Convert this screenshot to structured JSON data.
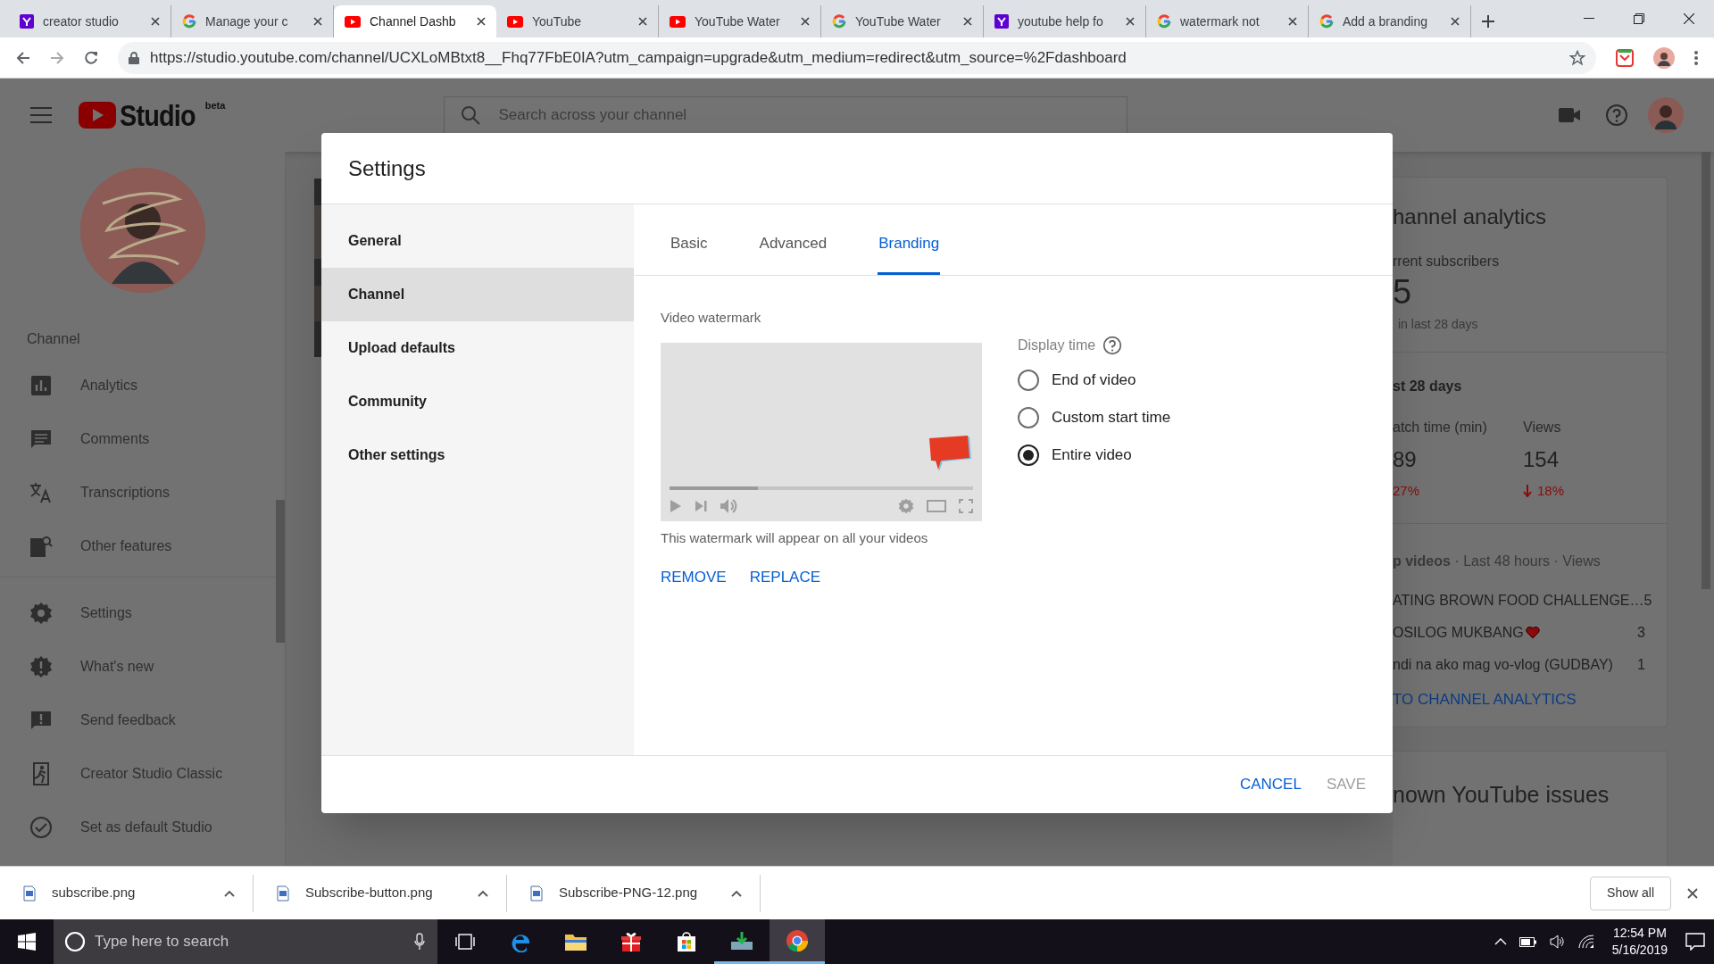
{
  "browser": {
    "tabs": [
      {
        "title": "creator studio",
        "kind": "purple",
        "selected": false
      },
      {
        "title": "Manage your c",
        "kind": "ring",
        "selected": false
      },
      {
        "title": "Channel Dashb",
        "kind": "play",
        "selected": true
      },
      {
        "title": "YouTube",
        "kind": "play",
        "selected": false
      },
      {
        "title": "YouTube Water",
        "kind": "play",
        "selected": false
      },
      {
        "title": "YouTube Water",
        "kind": "ring",
        "selected": false
      },
      {
        "title": "youtube help fo",
        "kind": "purple",
        "selected": false
      },
      {
        "title": "watermark not",
        "kind": "ring",
        "selected": false
      },
      {
        "title": "Add a branding",
        "kind": "ring",
        "selected": false
      }
    ],
    "url": "https://studio.youtube.com/channel/UCXLoMBtxt8__Fhq77FbE0IA?utm_campaign=upgrade&utm_medium=redirect&utm_source=%2Fdashboard"
  },
  "header": {
    "logo": "Studio",
    "badge": "beta",
    "search_placeholder": "Search across your channel"
  },
  "sidebar": {
    "section": "Channel",
    "items": [
      {
        "label": "Analytics"
      },
      {
        "label": "Comments"
      },
      {
        "label": "Transcriptions"
      },
      {
        "label": "Other features"
      }
    ],
    "footer_items": [
      {
        "label": "Settings"
      },
      {
        "label": "What's new"
      },
      {
        "label": "Send feedback"
      },
      {
        "label": "Creator Studio Classic"
      },
      {
        "label": "Set as default Studio"
      }
    ]
  },
  "analytics_card": {
    "title": "hannel analytics",
    "subscribers_label": "rrent subscribers",
    "subscribers": "5",
    "subscribers_note": "in last 28 days",
    "period": "st 28 days",
    "metrics": [
      {
        "label": "atch time (min)",
        "value": "89",
        "change": "27%",
        "arrow": false
      },
      {
        "label": "Views",
        "value": "154",
        "change": "18%",
        "arrow": true
      }
    ],
    "top_videos_heading": "**p videos** · Last 48 hours · Views",
    "top_videos": [
      {
        "title": "ATING BROWN FOOD CHALLENGE…",
        "views": "5",
        "heart": false
      },
      {
        "title": "OSILOG MUKBANG",
        "views": "3",
        "heart": true
      },
      {
        "title": "ndi na ako mag vo-vlog (GUDBAY)",
        "views": "1",
        "heart": false
      }
    ],
    "link": "TO CHANNEL ANALYTICS"
  },
  "issues_card": {
    "title": "nown YouTube issues"
  },
  "dialog": {
    "title": "Settings",
    "nav": [
      {
        "label": "General",
        "selected": false
      },
      {
        "label": "Channel",
        "selected": true
      },
      {
        "label": "Upload defaults",
        "selected": false
      },
      {
        "label": "Community",
        "selected": false
      },
      {
        "label": "Other settings",
        "selected": false
      }
    ],
    "tabs": [
      {
        "label": "Basic",
        "selected": false
      },
      {
        "label": "Advanced",
        "selected": false
      },
      {
        "label": "Branding",
        "selected": true
      }
    ],
    "section": "Video watermark",
    "preview": {
      "level": 0.29
    },
    "caption": "This watermark will appear on all your videos",
    "actions": [
      "REMOVE",
      "REPLACE"
    ],
    "display_time": "Display time",
    "options": [
      {
        "label": "End of video",
        "selected": false
      },
      {
        "label": "Custom start time",
        "selected": false
      },
      {
        "label": "Entire video",
        "selected": true
      }
    ],
    "cancel": "CANCEL",
    "save": {
      "label": "SAVE",
      "disabled": true
    }
  },
  "downloads": {
    "items": [
      {
        "name": "subscribe.png"
      },
      {
        "name": "Subscribe-button.png"
      },
      {
        "name": "Subscribe-PNG-12.png"
      }
    ],
    "show_all": "Show all"
  },
  "taskbar": {
    "search_placeholder": "Type here to search",
    "apps": [
      {
        "running": false,
        "selected": false
      },
      {
        "running": false,
        "selected": false
      },
      {
        "running": false,
        "selected": false
      },
      {
        "running": false,
        "selected": false
      },
      {
        "running": false,
        "selected": false
      },
      {
        "running": true,
        "selected": false
      },
      {
        "running": true,
        "selected": true
      }
    ],
    "time": "12:54 PM",
    "date": "5/16/2019"
  }
}
